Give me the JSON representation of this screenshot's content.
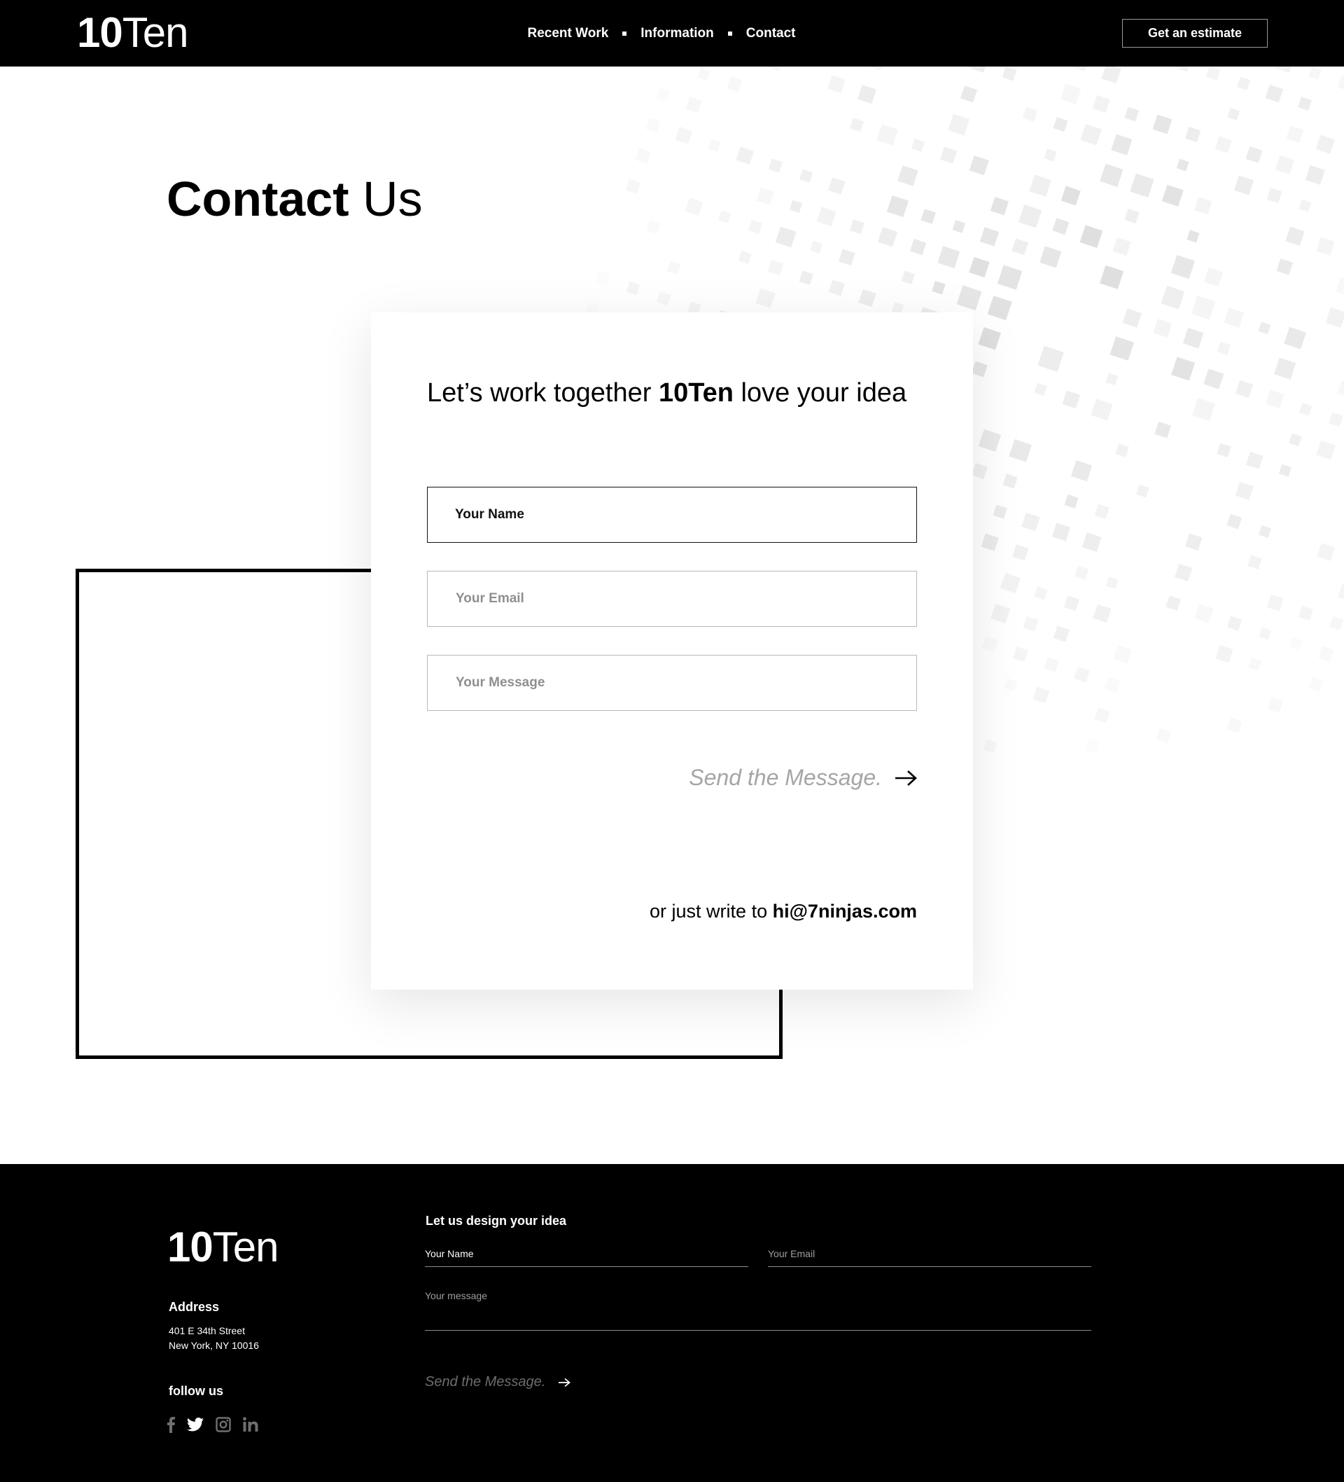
{
  "header": {
    "logo": {
      "bold": "10",
      "light": "Ten"
    },
    "nav": [
      "Recent Work",
      "Information",
      "Contact"
    ],
    "cta_label": "Get an estimate"
  },
  "page": {
    "title_bold": "Contact",
    "title_light": "Us"
  },
  "card": {
    "title_pre": "Let’s work together",
    "title_brand": "10Ten",
    "title_post": "love your idea",
    "fields": {
      "name_placeholder": "Your Name",
      "email_placeholder": "Your Email",
      "message_placeholder": "Your Message"
    },
    "send_label": "Send the Message.",
    "alt_prefix": "or just write to",
    "alt_email": "hi@7ninjas.com"
  },
  "footer": {
    "logo": {
      "bold": "10",
      "light": "Ten"
    },
    "address_heading": "Address",
    "address_line1": "401 E 34th Street",
    "address_line2": "New York, NY 10016",
    "follow_heading": "follow us",
    "socials": [
      "facebook-icon",
      "twitter-icon",
      "instagram-icon",
      "linkedin-icon"
    ],
    "form_heading": "Let us design your idea",
    "name_placeholder": "Your Name",
    "email_placeholder": "Your Email",
    "message_placeholder": "Your message",
    "send_label": "Send the Message."
  },
  "colors": {
    "black": "#000000",
    "white": "#ffffff",
    "placeholder_gray": "#8f8f8f",
    "send_gray": "#a5a5a5",
    "pattern_gray": "#e9e9e9"
  }
}
